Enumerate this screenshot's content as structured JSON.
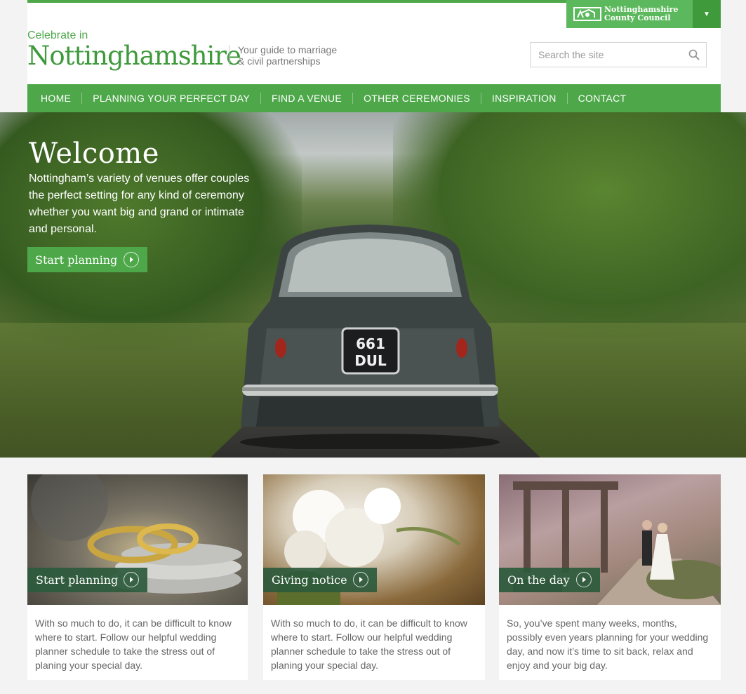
{
  "header": {
    "logo_small": "Celebrate in",
    "logo_big": "Nottinghamshire",
    "tagline_line1": "Your guide to marriage",
    "tagline_line2": "& civil partnerships",
    "council_line1": "Nottinghamshire",
    "council_line2": "County Council",
    "search_placeholder": "Search the site"
  },
  "nav": {
    "items": [
      "HOME",
      "PLANNING YOUR PERFECT DAY",
      "FIND A VENUE",
      "OTHER CEREMONIES",
      "INSPIRATION",
      "CONTACT"
    ]
  },
  "hero": {
    "title": "Welcome",
    "text": "Nottingham’s variety of venues offer couples the perfect setting for any kind of ceremony whether you want big and grand or intimate and personal.",
    "cta": "Start planning",
    "plate_line1": "661",
    "plate_line2": "DUL"
  },
  "cards": [
    {
      "label": "Start planning",
      "text": "With so much to do, it can be difficult to know where to start. Follow our helpful wedding planner schedule to take the stress out of planing your special day."
    },
    {
      "label": "Giving notice",
      "text": "With so much to do, it can be difficult to know where to start. Follow our helpful wedding planner schedule to take the stress out of planing your special day."
    },
    {
      "label": "On the day",
      "text": "So, you’ve spent many weeks, months, possibly even years planning for your wedding day, and now it’s time to sit back, relax and enjoy and your big day."
    }
  ],
  "colors": {
    "brand_green": "#4ea84a",
    "dark_green": "#3f9a3c",
    "card_label_bg": "#2d5a3c"
  }
}
